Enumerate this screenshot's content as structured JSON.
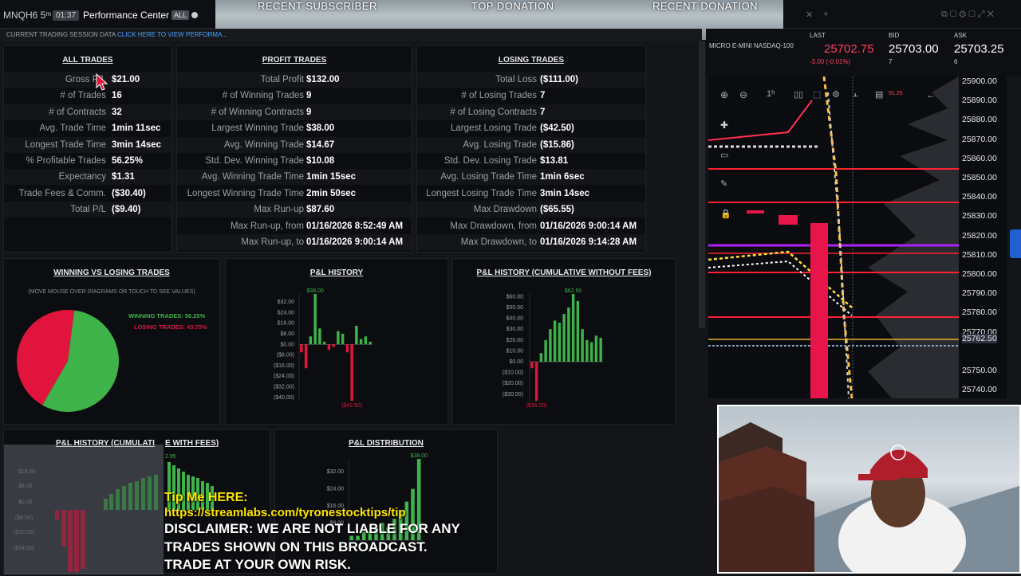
{
  "topbar": {
    "symbol": "MNQH6 5ᵐ",
    "time": "01:37",
    "title": "Performance Center",
    "badge": "ALL"
  },
  "overlay": {
    "recent_subscriber": "RECENT SUBSCRIBER",
    "top_donation": "TOP DONATION",
    "recent_donation": "RECENT DONATION"
  },
  "session": {
    "label": "CURRENT TRADING SESSION DATA",
    "link": "CLICK HERE TO VIEW PERFORMA..."
  },
  "all_trades": {
    "title": "ALL TRADES",
    "rows": [
      {
        "k": "Gross P/L",
        "v": "$21.00"
      },
      {
        "k": "# of Trades",
        "v": "16"
      },
      {
        "k": "# of Contracts",
        "v": "32"
      },
      {
        "k": "Avg. Trade Time",
        "v": "1min 11sec"
      },
      {
        "k": "Longest Trade Time",
        "v": "3min 14sec"
      },
      {
        "k": "% Profitable Trades",
        "v": "56.25%"
      },
      {
        "k": "Expectancy",
        "v": "$1.31"
      },
      {
        "k": "Trade Fees & Comm.",
        "v": "($30.40)"
      },
      {
        "k": "Total P/L",
        "v": "($9.40)"
      }
    ]
  },
  "profit_trades": {
    "title": "PROFIT TRADES",
    "rows": [
      {
        "k": "Total Profit",
        "v": "$132.00"
      },
      {
        "k": "# of Winning Trades",
        "v": "9"
      },
      {
        "k": "# of Winning Contracts",
        "v": "9"
      },
      {
        "k": "Largest Winning Trade",
        "v": "$38.00"
      },
      {
        "k": "Avg. Winning Trade",
        "v": "$14.67"
      },
      {
        "k": "Std. Dev. Winning Trade",
        "v": "$10.08"
      },
      {
        "k": "Avg. Winning Trade Time",
        "v": "1min 15sec"
      },
      {
        "k": "Longest Winning Trade Time",
        "v": "2min 50sec"
      },
      {
        "k": "Max Run-up",
        "v": "$87.60"
      },
      {
        "k": "Max Run-up, from",
        "v": "01/16/2026 8:52:49 AM"
      },
      {
        "k": "Max Run-up, to",
        "v": "01/16/2026 9:00:14 AM"
      }
    ]
  },
  "losing_trades": {
    "title": "LOSING TRADES",
    "rows": [
      {
        "k": "Total Loss",
        "v": "($111.00)"
      },
      {
        "k": "# of Losing Trades",
        "v": "7"
      },
      {
        "k": "# of Losing Contracts",
        "v": "7"
      },
      {
        "k": "Largest Losing Trade",
        "v": "($42.50)"
      },
      {
        "k": "Avg. Losing Trade",
        "v": "($15.86)"
      },
      {
        "k": "Std. Dev. Losing Trade",
        "v": "$13.81"
      },
      {
        "k": "Avg. Losing Trade Time",
        "v": "1min 6sec"
      },
      {
        "k": "Longest Losing Trade Time",
        "v": "3min 14sec"
      },
      {
        "k": "Max Drawdown",
        "v": "($65.55)"
      },
      {
        "k": "Max Drawdown, from",
        "v": "01/16/2026 9:00:14 AM"
      },
      {
        "k": "Max Drawdown, to",
        "v": "01/16/2026 9:14:28 AM"
      }
    ]
  },
  "charts": {
    "win_loss": {
      "title": "WINNING VS LOSING TRADES",
      "subtitle": "(MOVE MOUSE OVER DIAGRAMS OR TOUCH TO SEE VALUES)",
      "win_label": "WINNING TRADES: 56.25%",
      "loss_label": "LOSING TRADES: 43.75%"
    },
    "pl_history": {
      "title": "P&L HISTORY",
      "max_label": "$38.00",
      "min_label": "($42.50)"
    },
    "pl_cum": {
      "title": "P&L HISTORY (CUMULATIVE WITHOUT FEES)",
      "max_label": "$62.50",
      "min_label": "($36.00)"
    },
    "pl_cum_fees": {
      "title_left": "P&L HISTORY (CUMULATI",
      "title_right": "E WITH FEES)",
      "partial_label": "2.95"
    },
    "pl_dist": {
      "title": "P&L DISTRIBUTION",
      "max_label": "$38.00"
    }
  },
  "chart_data": [
    {
      "type": "pie",
      "labels": [
        "WINNING TRADES",
        "LOSING TRADES"
      ],
      "values": [
        56.25,
        43.75
      ],
      "colors": [
        "#3db34a",
        "#e0143c"
      ]
    },
    {
      "type": "bar",
      "title": "P&L HISTORY",
      "yticks": [
        "$32.00",
        "$24.00",
        "$16.00",
        "$8.00",
        "$0.00",
        "($8.00)",
        "($16.00)",
        "($24.00)",
        "($32.00)",
        "($40.00)"
      ],
      "ylim": [
        -42.5,
        38
      ],
      "values": [
        -6,
        -18,
        6,
        38,
        12,
        2,
        -4,
        -2,
        10,
        8,
        -6,
        -42.5,
        14,
        4,
        6,
        2
      ]
    },
    {
      "type": "bar",
      "title": "P&L HISTORY (CUMULATIVE WITHOUT FEES)",
      "yticks": [
        "$60.00",
        "$50.00",
        "$40.00",
        "$30.00",
        "$20.00",
        "$10.00",
        "$0.00",
        "($10.00)",
        "($20.00)",
        "($30.00)"
      ],
      "ylim": [
        -36,
        62.5
      ],
      "values": [
        -6,
        -36,
        8,
        20,
        30,
        38,
        36,
        44,
        50,
        62.5,
        56,
        30,
        20,
        18,
        24,
        22
      ]
    },
    {
      "type": "bar",
      "title": "P&L DISTRIBUTION",
      "yticks": [
        "$32.00",
        "$24.00",
        "$16.00",
        "$8.00"
      ],
      "ylim": [
        0,
        38
      ],
      "values": [
        2,
        2,
        4,
        4,
        6,
        8,
        6,
        10,
        14,
        18,
        24,
        38
      ]
    }
  ],
  "quote": {
    "instrument": "MICRO E-MINI NASDAQ-100",
    "last_label": "LAST",
    "last": "25702.75",
    "last_change": "-3.00 (-0.01%)",
    "bid_label": "BID",
    "bid": "25703.00",
    "bid_size": "7",
    "ask_label": "ASK",
    "ask": "25703.25",
    "ask_size": "6"
  },
  "price_scale": [
    "25900.00",
    "25890.00",
    "25880.00",
    "25870.00",
    "25860.00",
    "25850.00",
    "25840.00",
    "25830.00",
    "25820.00",
    "25810.00",
    "25800.00",
    "25790.00",
    "25780.00",
    "25770.00",
    "25762.50",
    "25750.00",
    "25740.00"
  ],
  "ticker_chip": "91.25",
  "colors": {
    "win": "#3db34a",
    "loss": "#e0143c",
    "link": "#4aa3ff",
    "tip": "#ffe600"
  },
  "stream": {
    "tip_label": "Tip Me HERE:",
    "tip_url": "https://streamlabs.com/tyronestocktips/tip",
    "disclaimer": [
      "DISCLAIMER: WE ARE NOT LIABLE FOR ANY",
      "TRADES SHOWN ON THIS BROADCAST.",
      "TRADE AT YOUR OWN RISK."
    ]
  }
}
